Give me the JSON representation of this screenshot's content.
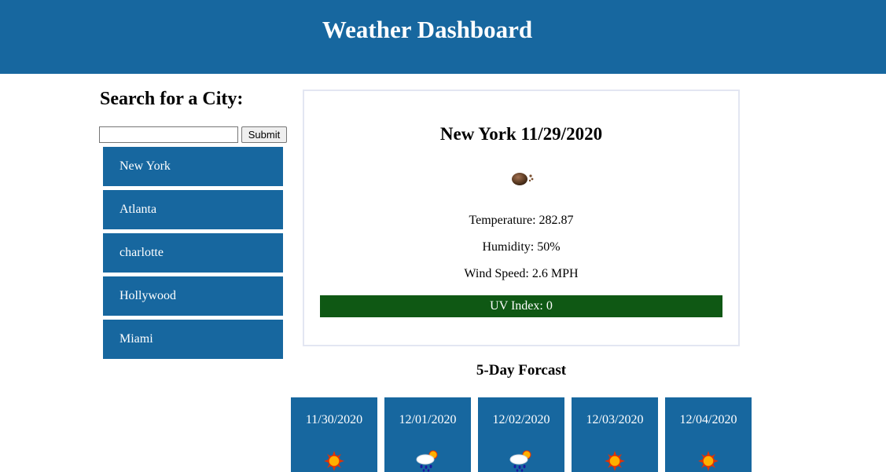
{
  "header": {
    "title": "Weather Dashboard"
  },
  "search": {
    "title": "Search for a City:",
    "input_value": "",
    "input_placeholder": "",
    "submit_label": "Submit"
  },
  "history": [
    {
      "label": "New York"
    },
    {
      "label": "Atlanta"
    },
    {
      "label": "charlotte"
    },
    {
      "label": "Hollywood"
    },
    {
      "label": "Miami"
    }
  ],
  "current": {
    "title": "New York 11/29/2020",
    "icon": "rain-cloud-icon",
    "temperature": "Temperature: 282.87",
    "humidity": "Humidity: 50%",
    "wind": "Wind Speed: 2.6 MPH",
    "uv": "UV Index: 0"
  },
  "forecast": {
    "title": "5-Day Forcast",
    "days": [
      {
        "date": "11/30/2020",
        "icon": "sun-icon"
      },
      {
        "date": "12/01/2020",
        "icon": "rain-sun-icon"
      },
      {
        "date": "12/02/2020",
        "icon": "rain-sun-icon"
      },
      {
        "date": "12/03/2020",
        "icon": "sun-icon"
      },
      {
        "date": "12/04/2020",
        "icon": "sun-icon"
      }
    ]
  },
  "colors": {
    "primary": "#17679f",
    "uv_low": "#0f5814",
    "card_border": "#e3e6f2"
  }
}
